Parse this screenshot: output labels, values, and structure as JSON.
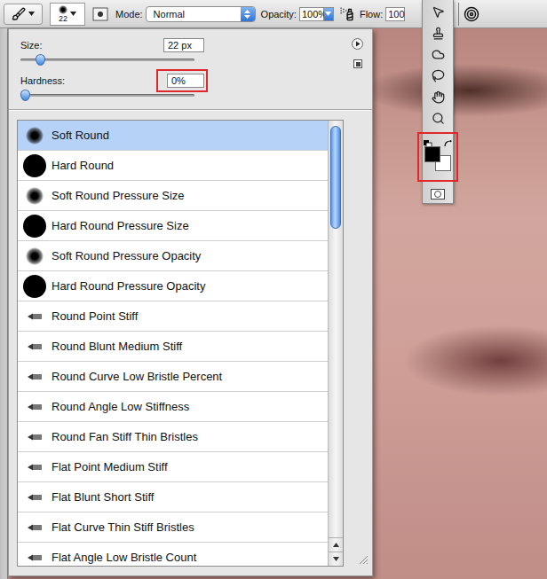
{
  "toolbar": {
    "brush_size": "22",
    "mode_label": "Mode:",
    "mode_value": "Normal",
    "opacity_label": "Opacity:",
    "opacity_value": "100%",
    "flow_label": "Flow:",
    "flow_value": "100"
  },
  "brush_panel": {
    "size_label": "Size:",
    "size_value": "22 px",
    "size_level": 0.11,
    "hardness_label": "Hardness:",
    "hardness_value": "0%",
    "hardness_level": 0,
    "hardness_highlighted": true
  },
  "presets": [
    {
      "name": "Soft Round",
      "kind": "soft",
      "selected": true
    },
    {
      "name": "Hard Round",
      "kind": "hard",
      "selected": false
    },
    {
      "name": "Soft Round Pressure Size",
      "kind": "soft",
      "selected": false
    },
    {
      "name": "Hard Round Pressure Size",
      "kind": "hard",
      "selected": false
    },
    {
      "name": "Soft Round Pressure Opacity",
      "kind": "soft",
      "selected": false
    },
    {
      "name": "Hard Round Pressure Opacity",
      "kind": "hard",
      "selected": false
    },
    {
      "name": "Round Point Stiff",
      "kind": "bristle",
      "selected": false
    },
    {
      "name": "Round Blunt Medium Stiff",
      "kind": "bristle",
      "selected": false
    },
    {
      "name": "Round Curve Low Bristle Percent",
      "kind": "bristle",
      "selected": false
    },
    {
      "name": "Round Angle Low Stiffness",
      "kind": "bristle",
      "selected": false
    },
    {
      "name": "Round Fan Stiff Thin Bristles",
      "kind": "bristle",
      "selected": false
    },
    {
      "name": "Flat Point Medium Stiff",
      "kind": "bristle",
      "selected": false
    },
    {
      "name": "Flat Blunt Short Stiff",
      "kind": "bristle",
      "selected": false
    },
    {
      "name": "Flat Curve Thin Stiff Bristles",
      "kind": "bristle",
      "selected": false
    },
    {
      "name": "Flat Angle Low Bristle Count",
      "kind": "bristle",
      "selected": false
    }
  ],
  "scrollbar": {
    "level": 0.25
  },
  "tools_panel": {
    "swatches_highlighted": true,
    "foreground_color": "#000000",
    "background_color": "#ffffff"
  }
}
